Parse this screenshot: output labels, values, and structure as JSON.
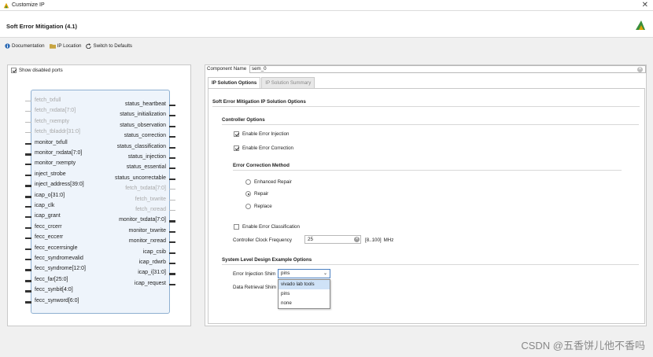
{
  "window": {
    "title": "Customize IP",
    "close_icon": "close-icon"
  },
  "header": {
    "title": "Soft Error Mitigation (4.1)"
  },
  "toolbar": {
    "documentation": "Documentation",
    "ip_location": "IP Location",
    "switch_defaults": "Switch to Defaults"
  },
  "left": {
    "show_disabled_label": "Show disabled ports",
    "left_ports": [
      {
        "name": "fetch_txfull",
        "disabled": true,
        "bus": false
      },
      {
        "name": "fetch_rxdata[7:0]",
        "disabled": true,
        "bus": true
      },
      {
        "name": "fetch_rxempty",
        "disabled": true,
        "bus": false
      },
      {
        "name": "fetch_tbladdr[31:0]",
        "disabled": true,
        "bus": true
      },
      {
        "name": "monitor_txfull",
        "disabled": false,
        "bus": false
      },
      {
        "name": "monitor_rxdata[7:0]",
        "disabled": false,
        "bus": true
      },
      {
        "name": "monitor_rxempty",
        "disabled": false,
        "bus": false
      },
      {
        "name": "inject_strobe",
        "disabled": false,
        "bus": false
      },
      {
        "name": "inject_address[39:0]",
        "disabled": false,
        "bus": true
      },
      {
        "name": "icap_o[31:0]",
        "disabled": false,
        "bus": true
      },
      {
        "name": "icap_clk",
        "disabled": false,
        "bus": false
      },
      {
        "name": "icap_grant",
        "disabled": false,
        "bus": false
      },
      {
        "name": "fecc_crcerr",
        "disabled": false,
        "bus": false
      },
      {
        "name": "fecc_eccerr",
        "disabled": false,
        "bus": false
      },
      {
        "name": "fecc_eccerrsingle",
        "disabled": false,
        "bus": false
      },
      {
        "name": "fecc_syndromevalid",
        "disabled": false,
        "bus": false
      },
      {
        "name": "fecc_syndrome[12:0]",
        "disabled": false,
        "bus": true
      },
      {
        "name": "fecc_far[25:0]",
        "disabled": false,
        "bus": true
      },
      {
        "name": "fecc_synbit[4:0]",
        "disabled": false,
        "bus": true
      },
      {
        "name": "fecc_synword[6:0]",
        "disabled": false,
        "bus": true
      }
    ],
    "right_ports": [
      {
        "name": "status_heartbeat",
        "disabled": false,
        "bus": false
      },
      {
        "name": "status_initialization",
        "disabled": false,
        "bus": false
      },
      {
        "name": "status_observation",
        "disabled": false,
        "bus": false
      },
      {
        "name": "status_correction",
        "disabled": false,
        "bus": false
      },
      {
        "name": "status_classification",
        "disabled": false,
        "bus": false
      },
      {
        "name": "status_injection",
        "disabled": false,
        "bus": false
      },
      {
        "name": "status_essential",
        "disabled": false,
        "bus": false
      },
      {
        "name": "status_uncorrectable",
        "disabled": false,
        "bus": false
      },
      {
        "name": "fetch_txdata[7:0]",
        "disabled": true,
        "bus": true
      },
      {
        "name": "fetch_txwrite",
        "disabled": true,
        "bus": false
      },
      {
        "name": "fetch_rxread",
        "disabled": true,
        "bus": false
      },
      {
        "name": "monitor_txdata[7:0]",
        "disabled": false,
        "bus": true
      },
      {
        "name": "monitor_txwrite",
        "disabled": false,
        "bus": false
      },
      {
        "name": "monitor_rxread",
        "disabled": false,
        "bus": false
      },
      {
        "name": "icap_csib",
        "disabled": false,
        "bus": false
      },
      {
        "name": "icap_rdwrb",
        "disabled": false,
        "bus": false
      },
      {
        "name": "icap_i[31:0]",
        "disabled": false,
        "bus": true
      },
      {
        "name": "icap_request",
        "disabled": false,
        "bus": false
      }
    ]
  },
  "right": {
    "component_name_label": "Component Name",
    "component_name_value": "sem_0",
    "tabs": [
      "IP Solution Options",
      "IP Solution Summary"
    ],
    "options_title": "Soft Error Mitigation IP Solution Options",
    "controller_options_title": "Controller Options",
    "enable_error_injection": "Enable Error Injection",
    "enable_error_correction": "Enable Error Correction",
    "correction_method_title": "Error Correction Method",
    "methods": [
      "Enhanced Repair",
      "Repair",
      "Replace"
    ],
    "selected_method": "Repair",
    "enable_error_classification": "Enable Error Classification",
    "clock_freq_label": "Controller Clock Frequency",
    "clock_freq_value": "25",
    "clock_freq_range": "[8..100]",
    "clock_freq_unit": "MHz",
    "example_options_title": "System Level Design Example Options",
    "injection_shim_label": "Error Injection Shim",
    "injection_shim_value": "pins",
    "retrieval_shim_label": "Data Retrieval Shim",
    "dropdown_options": [
      "vivado lab tools",
      "pins",
      "none"
    ]
  },
  "watermark": "CSDN @五香饼儿他不香吗"
}
